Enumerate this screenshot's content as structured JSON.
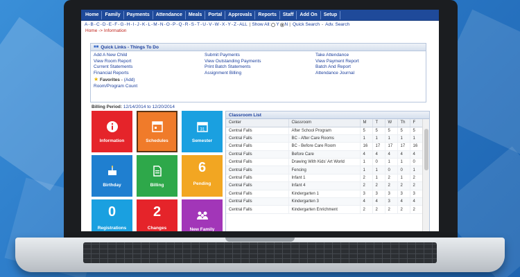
{
  "nav": [
    "Home",
    "Family",
    "Payments",
    "Attendance",
    "Meals",
    "Portal",
    "Approvals",
    "Reports",
    "Staff",
    "Add On",
    "Setup"
  ],
  "alphabet": [
    "A",
    "B",
    "C",
    "D",
    "E",
    "F",
    "G",
    "H",
    "I",
    "J",
    "K",
    "L",
    "M",
    "N",
    "O",
    "P",
    "Q",
    "R",
    "S",
    "T",
    "U",
    "V",
    "W",
    "X",
    "Y",
    "Z",
    "ALL"
  ],
  "show_all": {
    "label": "Show All:",
    "yes": "Y",
    "no": "N",
    "selected": "N"
  },
  "search_links": {
    "quick": "Quick Search",
    "advanced": "Adv. Search"
  },
  "breadcrumb": "Home -> Information",
  "quick_links": {
    "title": "Quick Links - Things To Do",
    "col1": [
      "Add A New Child",
      "View Room Report",
      "Current Statements",
      "Financial Reports"
    ],
    "col2": [
      "Submit Payments",
      "View Outstanding Payments",
      "Print Batch Statements",
      "Assignment Billing"
    ],
    "col3": [
      "Take Attendance",
      "View Payment Report",
      "Batch And Report",
      "Attendance Journal"
    ],
    "favorites_label": "Favorites",
    "favorites_add": "(Add)",
    "favorite_link": "Room/Program Count"
  },
  "billing": {
    "label": "Billing Period:",
    "start": "12/14/2014",
    "to": "to",
    "end": "12/20/2014"
  },
  "tiles": [
    {
      "label": "Information",
      "icon": "info-icon",
      "color": "#e5242a"
    },
    {
      "label": "Schedules",
      "icon": "schedule-icon",
      "color": "#f07b2a"
    },
    {
      "label": "Semester",
      "icon": "calendar-icon",
      "color": "#1aa0e0"
    },
    {
      "label": "Birthday",
      "icon": "birthday-cake-icon",
      "color": "#1f7fd0"
    },
    {
      "label": "Billing",
      "icon": "billing-document-icon",
      "color": "#2ea84a"
    },
    {
      "label": "Pending",
      "number": "6",
      "color": "#f2a622"
    },
    {
      "label": "Registrations",
      "number": "0",
      "color": "#1aa0e0"
    },
    {
      "label": "Changes",
      "number": "2",
      "color": "#e5242a"
    },
    {
      "label": "New Family",
      "icon": "family-icon",
      "color": "#a236b8"
    }
  ],
  "classroom": {
    "title": "Classroom List",
    "columns": [
      "Center",
      "Classroom",
      "M",
      "T",
      "W",
      "Th",
      "F"
    ],
    "rows": [
      [
        "Central Falls",
        "After School Program",
        "5",
        "5",
        "5",
        "5",
        "5"
      ],
      [
        "Central Falls",
        "BC - After Care Rooms",
        "1",
        "1",
        "1",
        "1",
        "1"
      ],
      [
        "Central Falls",
        "BC - Before Care Room",
        "16",
        "17",
        "17",
        "17",
        "16"
      ],
      [
        "Central Falls",
        "Before Care",
        "4",
        "4",
        "4",
        "4",
        "4"
      ],
      [
        "Central Falls",
        "Drawing With Kids' Art World",
        "1",
        "0",
        "1",
        "1",
        "0"
      ],
      [
        "Central Falls",
        "Fencing",
        "1",
        "1",
        "0",
        "0",
        "1"
      ],
      [
        "Central Falls",
        "Infant 1",
        "2",
        "1",
        "2",
        "1",
        "2"
      ],
      [
        "Central Falls",
        "Infant 4",
        "2",
        "2",
        "2",
        "2",
        "2"
      ],
      [
        "Central Falls",
        "Kindergarten 1",
        "3",
        "3",
        "3",
        "3",
        "3"
      ],
      [
        "Central Falls",
        "Kindergarten 3",
        "4",
        "4",
        "3",
        "4",
        "4"
      ],
      [
        "Central Falls",
        "Kindergarten Enrichment",
        "2",
        "2",
        "2",
        "2",
        "2"
      ]
    ]
  }
}
